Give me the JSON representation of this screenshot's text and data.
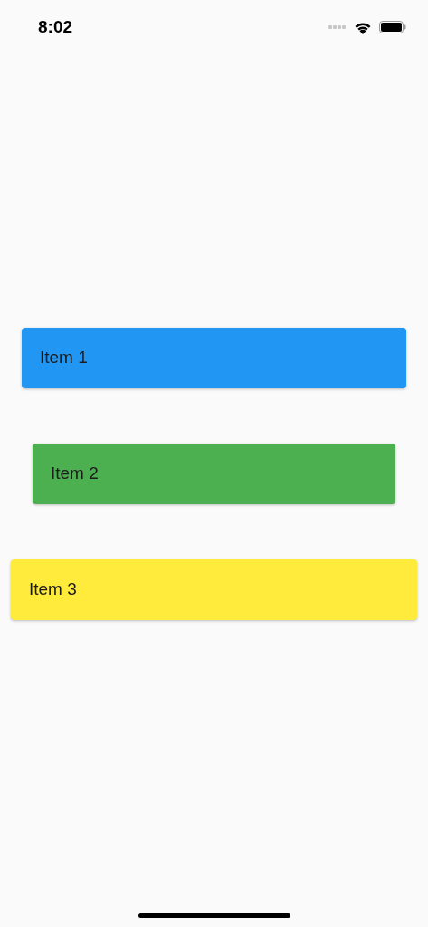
{
  "status_bar": {
    "time": "8:02"
  },
  "items": [
    {
      "label": "Item 1",
      "color": "#2196f3"
    },
    {
      "label": "Item 2",
      "color": "#4caf50"
    },
    {
      "label": "Item 3",
      "color": "#ffeb3b"
    }
  ]
}
